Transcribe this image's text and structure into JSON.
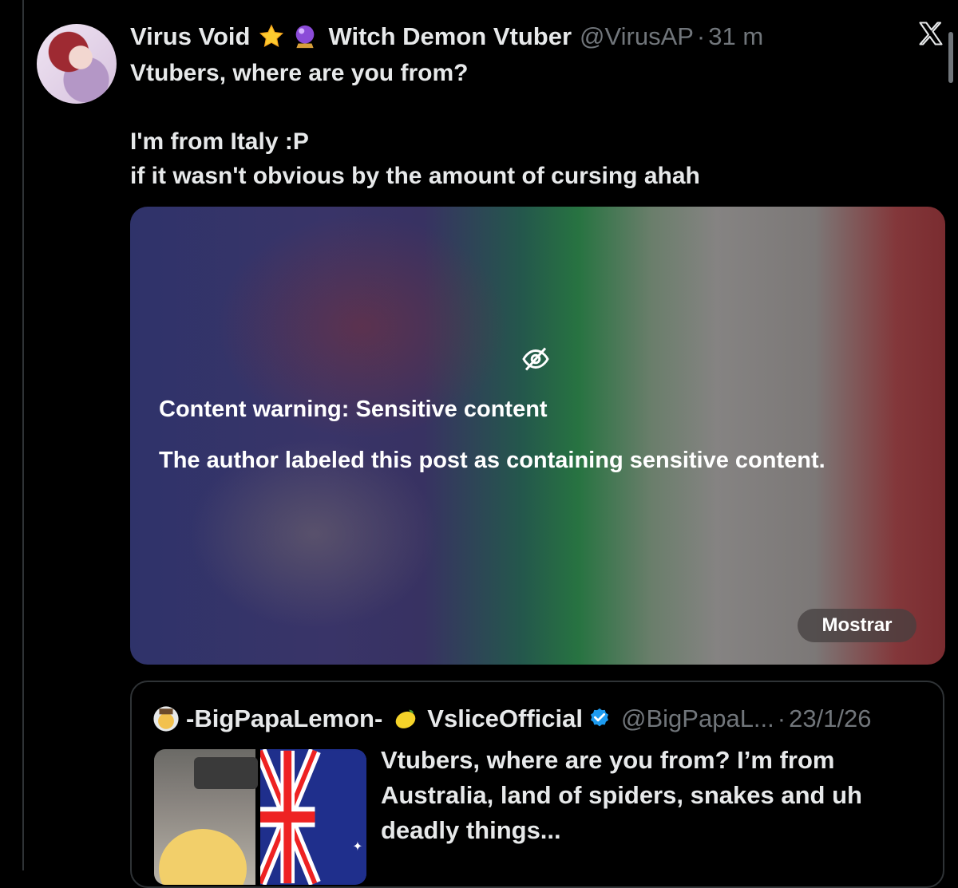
{
  "post": {
    "display_name": "Virus Void",
    "name_suffix": "Witch Demon Vtuber",
    "handle": "@VirusAP",
    "separator": "·",
    "time": "31 m",
    "text": "Vtubers, where are you from?\n\nI'm from Italy :P\nif it wasn't obvious by the amount of cursing ahah",
    "emoji": [
      "star-emoji",
      "crystal-ball-emoji"
    ]
  },
  "media": {
    "icon": "eye-slash-icon",
    "warning_title": "Content warning: Sensitive content",
    "warning_body": "The author labeled this post as containing sensitive content.",
    "show_label": "Mostrar"
  },
  "quote": {
    "display_name": "-BigPapaLemon-",
    "name_suffix": "VsliceOfficial",
    "handle": "@BigPapaL...",
    "separator": "·",
    "date": "23/1/26",
    "verified_color": "#1d9bf0",
    "text": "Vtubers, where are you from? I’m from\nAustralia, land of spiders, snakes and uh\ndeadly things..."
  },
  "colors": {
    "background": "#000000",
    "text": "#e7e9ea",
    "muted": "#71767b"
  }
}
